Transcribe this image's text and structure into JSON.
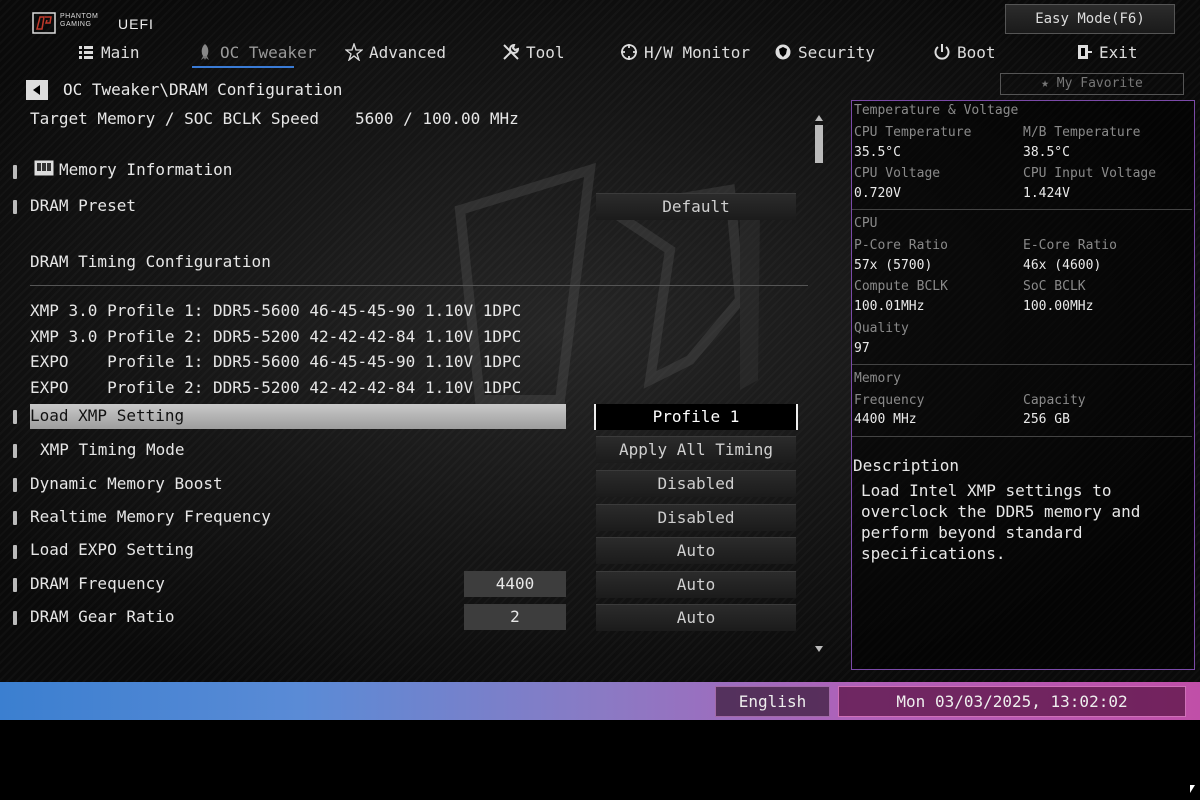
{
  "header": {
    "brand_line1": "PHANTOM",
    "brand_line2": "GAMING",
    "uefi": "UEFI",
    "easy_mode": "Easy Mode(F6)",
    "my_favorite": "My Favorite"
  },
  "tabs": [
    {
      "label": "Main",
      "icon": "list-icon"
    },
    {
      "label": "OC Tweaker",
      "icon": "rocket-icon",
      "active": true
    },
    {
      "label": "Advanced",
      "icon": "star-icon"
    },
    {
      "label": "Tool",
      "icon": "wrench-icon"
    },
    {
      "label": "H/W Monitor",
      "icon": "crosshair-icon"
    },
    {
      "label": "Security",
      "icon": "shield-icon"
    },
    {
      "label": "Boot",
      "icon": "power-icon"
    },
    {
      "label": "Exit",
      "icon": "exit-icon"
    }
  ],
  "breadcrumb": "OC Tweaker\\DRAM Configuration",
  "content": {
    "target_label": "Target Memory / SOC BCLK Speed",
    "target_value": "5600 / 100.00 MHz",
    "memory_info": "Memory Information",
    "dram_preset": {
      "label": "DRAM Preset",
      "value": "Default"
    },
    "timing_config": "DRAM Timing Configuration",
    "profiles": [
      "XMP 3.0 Profile 1: DDR5-5600 46-45-45-90 1.10V 1DPC",
      "XMP 3.0 Profile 2: DDR5-5200 42-42-42-84 1.10V 1DPC",
      "EXPO    Profile 1: DDR5-5600 46-45-45-90 1.10V 1DPC",
      "EXPO    Profile 2: DDR5-5200 42-42-42-84 1.10V 1DPC"
    ],
    "settings": [
      {
        "label": "Load XMP Setting",
        "value": "Profile 1"
      },
      {
        "label": "XMP Timing Mode",
        "value": "Apply All Timing"
      },
      {
        "label": "Dynamic Memory Boost",
        "value": "Disabled"
      },
      {
        "label": "Realtime Memory Frequency",
        "value": "Disabled"
      },
      {
        "label": "Load EXPO Setting",
        "value": "Auto"
      },
      {
        "label": "DRAM Frequency",
        "value": "Auto",
        "current": "4400"
      },
      {
        "label": "DRAM Gear Ratio",
        "value": "Auto",
        "current": "2"
      }
    ]
  },
  "monitor": {
    "tv_title": "Temperature & Voltage",
    "cpu_temp_label": "CPU Temperature",
    "cpu_temp": "35.5°C",
    "mb_temp_label": "M/B Temperature",
    "mb_temp": "38.5°C",
    "cpu_volt_label": "CPU Voltage",
    "cpu_volt": "0.720V",
    "cpu_in_volt_label": "CPU Input Voltage",
    "cpu_in_volt": "1.424V",
    "cpu_title": "CPU",
    "pcore_label": "P-Core Ratio",
    "pcore": "57x (5700)",
    "ecore_label": "E-Core Ratio",
    "ecore": "46x (4600)",
    "cbclk_label": "Compute BCLK",
    "cbclk": "100.01MHz",
    "socbclk_label": "SoC BCLK",
    "socbclk": "100.00MHz",
    "quality_label": "Quality",
    "quality": "97",
    "mem_title": "Memory",
    "freq_label": "Frequency",
    "freq": "4400 MHz",
    "cap_label": "Capacity",
    "cap": "256 GB"
  },
  "description": {
    "title": "Description",
    "text": "Load Intel XMP settings to overclock the DDR5 memory and perform beyond standard specifications."
  },
  "footer": {
    "language": "English",
    "datetime": "Mon 03/03/2025, 13:02:02"
  }
}
